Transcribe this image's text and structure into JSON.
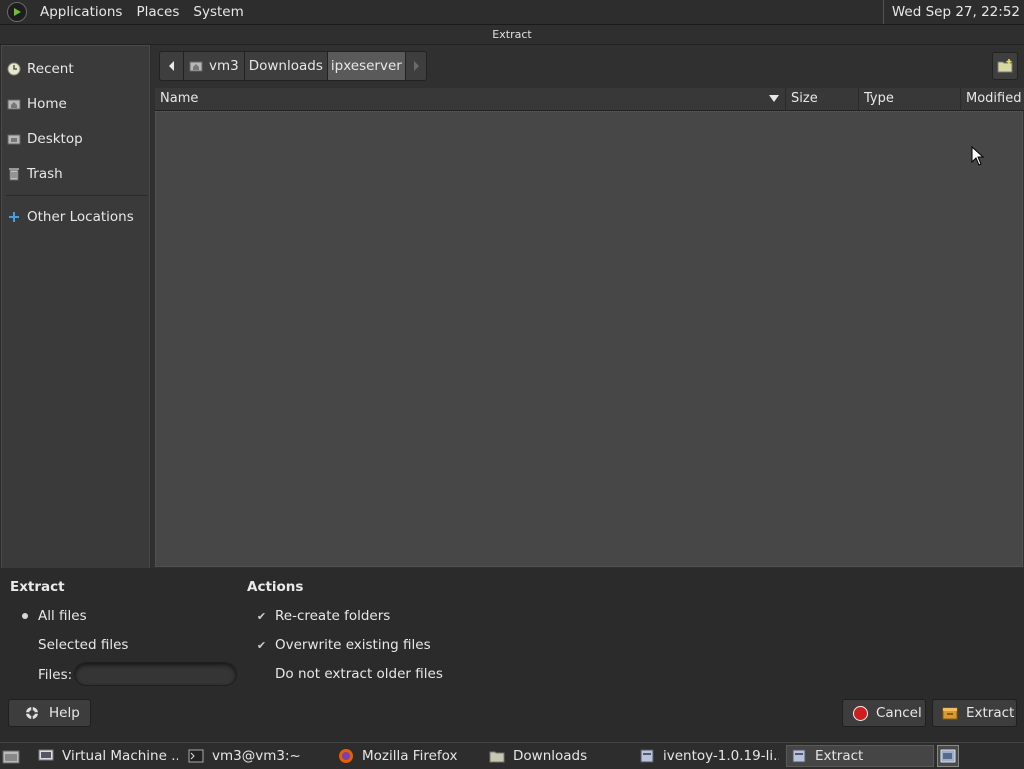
{
  "top_panel": {
    "menus": [
      "Applications",
      "Places",
      "System"
    ],
    "clock": "Wed Sep 27, 22:52"
  },
  "window": {
    "title": "Extract"
  },
  "sidebar": {
    "items": [
      {
        "label": "Recent",
        "icon": "recent-icon"
      },
      {
        "label": "Home",
        "icon": "home-folder-icon"
      },
      {
        "label": "Desktop",
        "icon": "desktop-folder-icon"
      },
      {
        "label": "Trash",
        "icon": "trash-icon"
      },
      {
        "label": "Other Locations",
        "icon": "plus-icon"
      }
    ]
  },
  "pathbar": {
    "segments": [
      "vm3",
      "Downloads",
      "ipxeserver"
    ],
    "active": "ipxeserver"
  },
  "columns": [
    "Name",
    "Size",
    "Type",
    "Modified"
  ],
  "options": {
    "extract_heading": "Extract",
    "all_files": "All files",
    "selected_files": "Selected files",
    "files_label": "Files:",
    "files_value": "",
    "actions_heading": "Actions",
    "recreate_folders": "Re-create folders",
    "overwrite": "Overwrite existing files",
    "no_older": "Do not extract older files"
  },
  "buttons": {
    "help": "Help",
    "cancel": "Cancel",
    "extract": "Extract"
  },
  "taskbar": {
    "tasks": [
      {
        "label": "Virtual Machine ...",
        "icon": "virtual-machine-icon"
      },
      {
        "label": "vm3@vm3:~",
        "icon": "terminal-icon"
      },
      {
        "label": "Mozilla Firefox",
        "icon": "firefox-icon"
      },
      {
        "label": "Downloads",
        "icon": "folder-icon"
      },
      {
        "label": "iventoy-1.0.19-li...",
        "icon": "archive-icon"
      },
      {
        "label": "Extract",
        "icon": "archive-icon"
      }
    ]
  },
  "colors": {
    "accent_blue": "#4f9bd8",
    "cancel_red": "#cc2020",
    "firefox_orange": "#e66000"
  }
}
